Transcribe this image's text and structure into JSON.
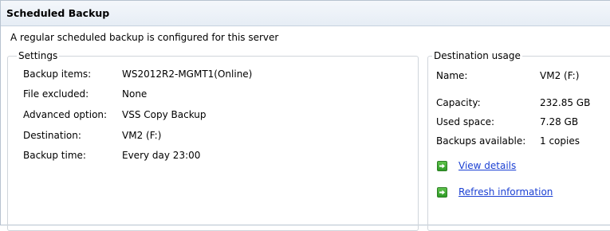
{
  "header": {
    "title": "Scheduled Backup"
  },
  "subtitle": "A regular scheduled backup is configured for this server",
  "settings": {
    "legend": "Settings",
    "rows": [
      {
        "label": "Backup items:",
        "value": "WS2012R2-MGMT1(Online)"
      },
      {
        "label": "File excluded:",
        "value": "None"
      },
      {
        "label": "Advanced option:",
        "value": "VSS Copy Backup"
      },
      {
        "label": "Destination:",
        "value": "VM2 (F:)"
      },
      {
        "label": "Backup time:",
        "value": "Every day 23:00"
      }
    ]
  },
  "destination": {
    "legend": "Destination usage",
    "name_label": "Name:",
    "name_value": "VM2 (F:)",
    "rows": [
      {
        "label": "Capacity:",
        "value": "232.85 GB"
      },
      {
        "label": "Used space:",
        "value": "7.28 GB"
      },
      {
        "label": "Backups available:",
        "value": "1 copies"
      }
    ],
    "links": [
      {
        "label": "View details",
        "icon": "green-arrow-icon"
      },
      {
        "label": "Refresh information",
        "icon": "green-arrow-icon"
      }
    ]
  }
}
